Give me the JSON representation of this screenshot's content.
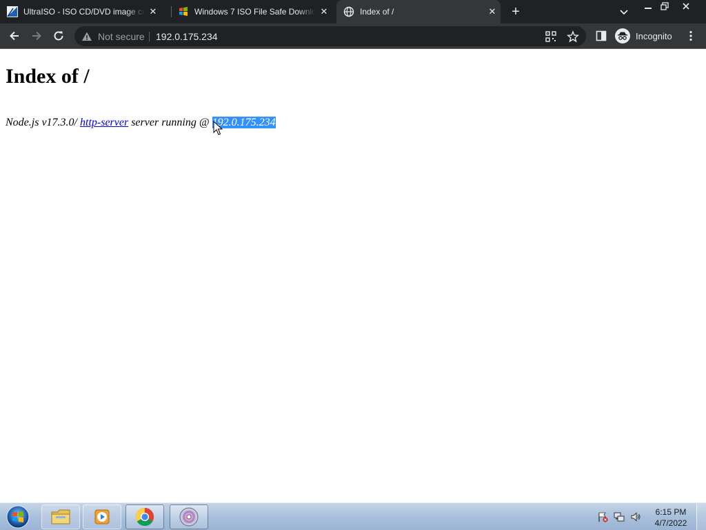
{
  "browser": {
    "tabs": [
      {
        "title": "UltraISO - ISO CD/DVD image creator",
        "favicon": "ultraiso-icon",
        "active": false
      },
      {
        "title": "Windows 7 ISO File Safe Download",
        "favicon": "windows-flag-icon",
        "active": false
      },
      {
        "title": "Index of /",
        "favicon": "globe-icon",
        "active": true
      }
    ],
    "new_tab_label": "+",
    "omnibox": {
      "security_label": "Not secure",
      "url": "192.0.175.234"
    },
    "incognito_label": "Incognito"
  },
  "page": {
    "heading": "Index of /",
    "footer": {
      "prefix": "Node.js v17.3.0/ ",
      "link_text": "http-server",
      "middle": " server running @ ",
      "host": "192.0.175.234"
    }
  },
  "taskbar": {
    "clock_time": "6:15 PM",
    "clock_date": "4/7/2022"
  },
  "colors": {
    "tabstrip": "#202124",
    "toolbar": "#35363a",
    "omnibox": "#202124",
    "selection": "#3390ff",
    "link": "#0000ee"
  }
}
